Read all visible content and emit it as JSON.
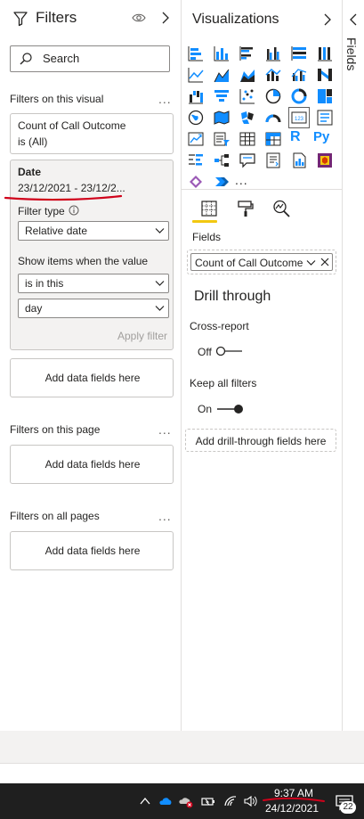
{
  "filters_pane": {
    "title": "Filters",
    "search_placeholder": "Search",
    "section_visual": "Filters on this visual",
    "section_page": "Filters on this page",
    "section_all": "Filters on all pages",
    "more_label": "...",
    "call_outcome_card": {
      "line1": "Count of Call Outcome",
      "line2": "is (All)"
    },
    "date_card": {
      "title": "Date",
      "range": "23/12/2021 - 23/12/2...",
      "filter_type_label": "Filter type",
      "filter_type_value": "Relative date",
      "show_items_label": "Show items when the value",
      "operator_value": "is in this",
      "unit_value": "day",
      "apply_label": "Apply filter"
    },
    "add_fields_label": "Add data fields here"
  },
  "viz_pane": {
    "title": "Visualizations",
    "fields_label": "Fields",
    "field_pill": "Count of Call Outcome",
    "drill_title": "Drill through",
    "cross_report_label": "Cross-report",
    "cross_report_state": "Off",
    "keep_filters_label": "Keep all filters",
    "keep_filters_state": "On",
    "drill_well_label": "Add drill-through fields here",
    "more_visuals": "...",
    "r_label": "R",
    "py_label": "Py",
    "icons": [
      "stacked-bar-icon",
      "stacked-column-icon",
      "clustered-bar-icon",
      "clustered-column-icon",
      "100-bar-icon",
      "100-column-icon",
      "line-chart-icon",
      "area-chart-icon",
      "stacked-area-icon",
      "line-column-icon",
      "line-clustered-column-icon",
      "ribbon-chart-icon",
      "waterfall-icon",
      "funnel-icon",
      "scatter-icon",
      "pie-icon",
      "donut-icon",
      "treemap-icon",
      "map-icon",
      "filled-map-icon",
      "shape-map-icon",
      "gauge-icon",
      "card-icon",
      "multirow-card-icon",
      "kpi-icon",
      "slicer-icon",
      "table-icon",
      "matrix-icon",
      "r-visual-icon",
      "python-visual-icon",
      "key-influencers-icon",
      "decomposition-tree-icon",
      "qa-icon",
      "smart-narrative-icon",
      "paginated-report-icon",
      "power-apps-icon",
      "power-automate-icon",
      "arcgis-icon"
    ]
  },
  "fields_strip": {
    "label": "Fields"
  },
  "taskbar": {
    "time": "9:37 AM",
    "date": "24/12/2021",
    "notifications_count": "22"
  },
  "colors": {
    "accent_yellow": "#f2c811",
    "annotation_red": "#d0021b",
    "taskbar": "#1f1f1f"
  }
}
